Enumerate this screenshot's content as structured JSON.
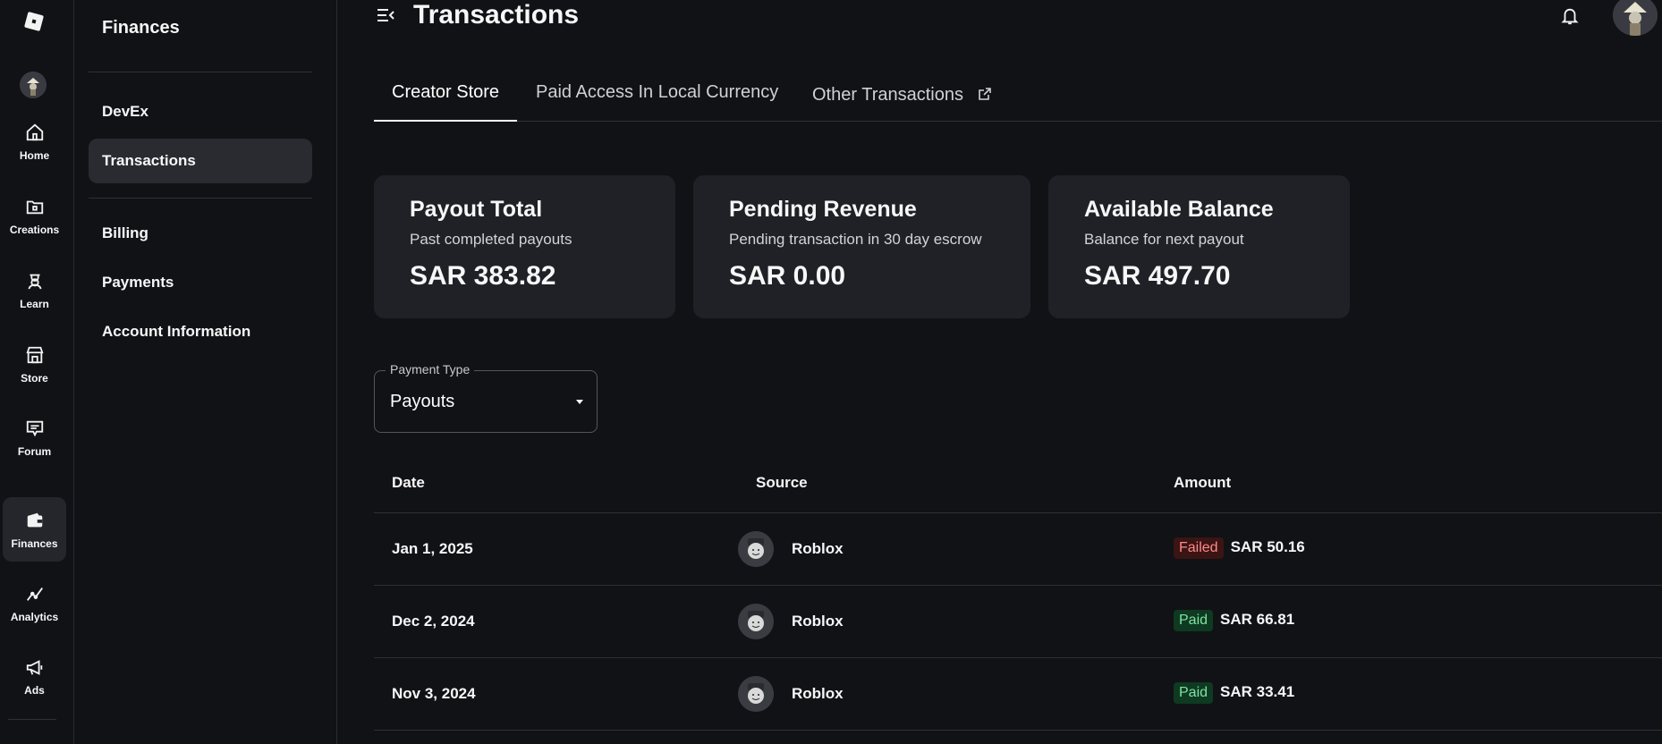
{
  "rail": {
    "items": [
      {
        "label": "Home",
        "icon": "home-icon"
      },
      {
        "label": "Creations",
        "icon": "creations-icon"
      },
      {
        "label": "Learn",
        "icon": "learn-icon"
      },
      {
        "label": "Store",
        "icon": "store-icon"
      },
      {
        "label": "Forum",
        "icon": "forum-icon"
      },
      {
        "label": "Finances",
        "icon": "wallet-icon",
        "active": true
      },
      {
        "label": "Analytics",
        "icon": "analytics-icon"
      },
      {
        "label": "Ads",
        "icon": "megaphone-icon"
      }
    ]
  },
  "subnav": {
    "title": "Finances",
    "items": [
      {
        "label": "DevEx"
      },
      {
        "label": "Transactions",
        "active": true
      },
      {
        "label": "Billing"
      },
      {
        "label": "Payments"
      },
      {
        "label": "Account Information"
      }
    ]
  },
  "header": {
    "title": "Transactions"
  },
  "tabs": [
    {
      "label": "Creator Store",
      "active": true
    },
    {
      "label": "Paid Access In Local Currency"
    },
    {
      "label": "Other Transactions",
      "icon": "external-link-icon"
    }
  ],
  "cards": [
    {
      "title": "Payout Total",
      "subtitle": "Past completed payouts",
      "value": "SAR 383.82"
    },
    {
      "title": "Pending Revenue",
      "subtitle": "Pending transaction in 30 day escrow",
      "value": "SAR 0.00"
    },
    {
      "title": "Available Balance",
      "subtitle": "Balance for next payout",
      "value": "SAR 497.70"
    }
  ],
  "filter": {
    "label": "Payment Type",
    "value": "Payouts"
  },
  "table": {
    "columns": [
      "Date",
      "Source",
      "Amount"
    ],
    "rows": [
      {
        "date": "Jan 1, 2025",
        "source": "Roblox",
        "status": "Failed",
        "amount": "SAR 50.16"
      },
      {
        "date": "Dec 2, 2024",
        "source": "Roblox",
        "status": "Paid",
        "amount": "SAR 66.81"
      },
      {
        "date": "Nov 3, 2024",
        "source": "Roblox",
        "status": "Paid",
        "amount": "SAR 33.41"
      }
    ]
  },
  "colors": {
    "background": "#111216",
    "card": "#202126",
    "failed_bg": "#3b1414",
    "failed_fg": "#ff8a8a",
    "paid_bg": "#0f3a22",
    "paid_fg": "#7ee2a2"
  }
}
